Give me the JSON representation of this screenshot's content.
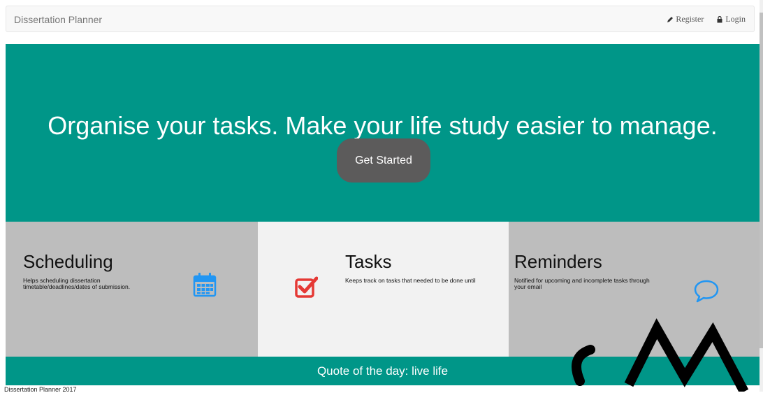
{
  "navbar": {
    "brand": "Dissertation Planner",
    "register_label": "Register",
    "login_label": "Login",
    "register_icon": "pencil-icon",
    "login_icon": "lock-icon"
  },
  "hero": {
    "title": "Organise your tasks. Make your life study easier to manage.",
    "cta_label": "Get Started"
  },
  "features": [
    {
      "title": "Scheduling",
      "desc": "Helps scheduling dissertation timetable/deadlines/dates of submission.",
      "icon": "calendar-icon"
    },
    {
      "title": "Tasks",
      "desc": "Keeps track on tasks that needed to be done until",
      "icon": "checkbox-icon"
    },
    {
      "title": "Reminders",
      "desc": "Notified for upcoming and incomplete tasks through your email",
      "icon": "speech-bubble-icon"
    }
  ],
  "quote": "Quote of the day: live life",
  "footer": "Dissertation Planner 2017",
  "colors": {
    "primary": "#009688",
    "button": "#5c5b5b",
    "feature_grey": "#bdbdbd",
    "feature_light": "#f2f2f2",
    "icon_blue": "#2196f3",
    "icon_red": "#e53935"
  }
}
